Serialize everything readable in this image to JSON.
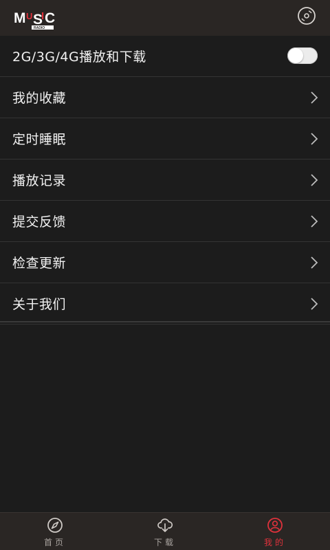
{
  "header": {
    "logo_main": "MUSIC",
    "logo_sub": "RADIO",
    "disc_icon": "disc-icon"
  },
  "settings": {
    "network_toggle": {
      "label": "2G/3G/4G播放和下载",
      "enabled": false
    },
    "items": [
      {
        "label": "我的收藏"
      },
      {
        "label": "定时睡眠"
      },
      {
        "label": "播放记录"
      },
      {
        "label": "提交反馈"
      },
      {
        "label": "检查更新"
      },
      {
        "label": "关于我们"
      }
    ]
  },
  "tabbar": {
    "tabs": [
      {
        "label": "首页",
        "icon": "compass-icon",
        "active": false
      },
      {
        "label": "下载",
        "icon": "cloud-download-icon",
        "active": false
      },
      {
        "label": "我的",
        "icon": "user-icon",
        "active": true
      }
    ]
  },
  "colors": {
    "accent": "#e0323c",
    "background": "#1c1c1c",
    "bar": "#2a2624"
  }
}
